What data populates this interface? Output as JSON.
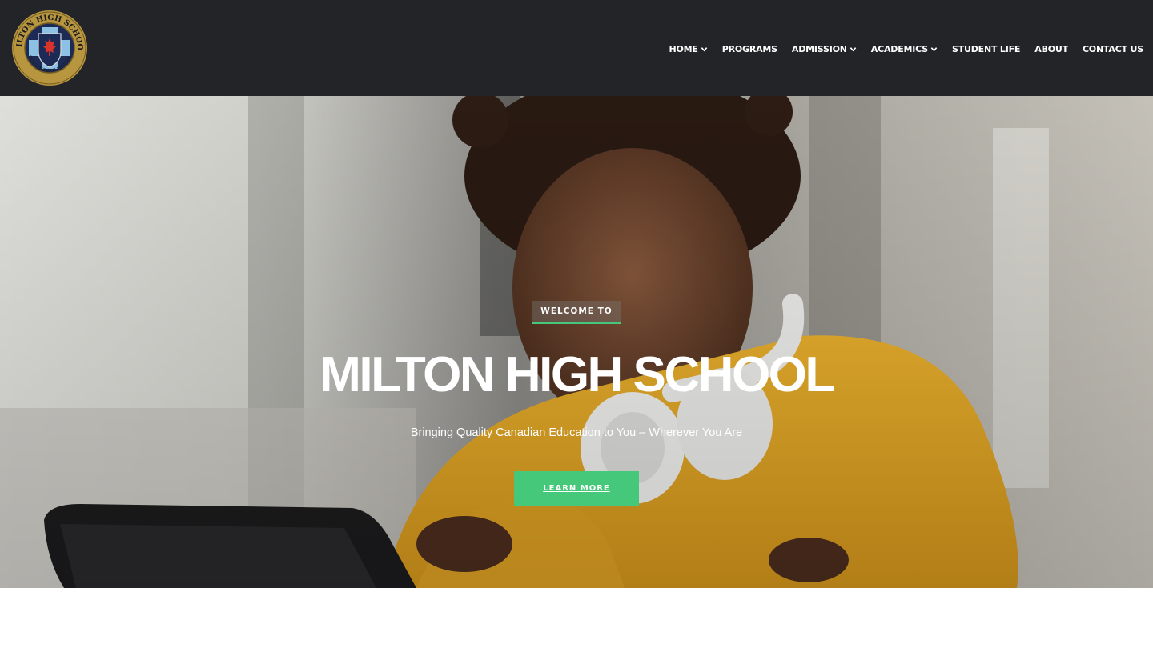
{
  "header": {
    "logo": {
      "top_text": "MILTON HIGH SCHOOL",
      "bottom_text": "TORONTO CANADA"
    },
    "nav": [
      {
        "label": "HOME",
        "has_dropdown": true
      },
      {
        "label": "PROGRAMS",
        "has_dropdown": false
      },
      {
        "label": "ADMISSION",
        "has_dropdown": true
      },
      {
        "label": "ACADEMICS",
        "has_dropdown": true
      },
      {
        "label": "STUDENT LIFE",
        "has_dropdown": false
      },
      {
        "label": "ABOUT",
        "has_dropdown": false
      },
      {
        "label": "CONTACT US",
        "has_dropdown": false
      }
    ],
    "icons": {
      "dropdown": "chevron-down-icon"
    }
  },
  "hero": {
    "eyebrow": "WELCOME TO",
    "title": "MILTON HIGH SCHOOL",
    "subtitle": "Bringing Quality Canadian Education to You – Wherever You Are",
    "cta_label": "LEARN MORE",
    "image_subject": "student-with-headphones-photo"
  },
  "colors": {
    "header_bg": "#222428",
    "accent_green": "#46c87a",
    "sweater_yellow": "#e8a92a",
    "text_white": "#ffffff"
  }
}
